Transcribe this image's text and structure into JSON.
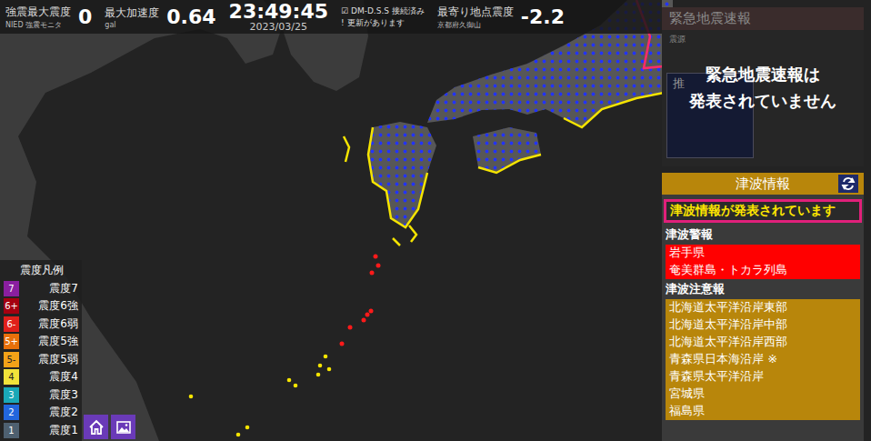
{
  "top_bar": {
    "max_intensity": {
      "label": "強震最大震度",
      "sub": "NIED 強震モニタ",
      "value": "0"
    },
    "max_acceleration": {
      "label": "最大加速度",
      "sub": "gal",
      "value": "0.64"
    },
    "clock": {
      "time": "23:49:45",
      "date": "2023/03/25"
    },
    "dmdss": {
      "icon": "☑",
      "status": "DM-D.S.S 接続済み",
      "update_icon": "!",
      "update": "更新があります"
    },
    "nearest": {
      "label": "最寄り地点震度",
      "sub": "京都府久御山",
      "value": "-2.2"
    }
  },
  "eew": {
    "title": "緊急地震速報",
    "hypocenter_label": "震源",
    "hidden_label": "推",
    "message_lines": [
      "緊急地震速報は",
      "発表されていません"
    ]
  },
  "tsunami": {
    "title": "津波情報",
    "status": "津波情報が発表されています",
    "groups": [
      {
        "label": "津波警報",
        "kind": "warning",
        "areas": [
          "岩手県",
          "奄美群島・トカラ列島"
        ]
      },
      {
        "label": "津波注意報",
        "kind": "advisory",
        "areas": [
          "北海道太平洋沿岸東部",
          "北海道太平洋沿岸中部",
          "北海道太平洋沿岸西部",
          "青森県日本海沿岸 ※",
          "青森県太平洋沿岸",
          "宮城県",
          "福島県"
        ]
      }
    ]
  },
  "legend": {
    "title": "震度凡例",
    "items": [
      {
        "badge": "7",
        "label": "震度7",
        "color": "#8a1fa0"
      },
      {
        "badge": "6+",
        "label": "震度6強",
        "color": "#a50010"
      },
      {
        "badge": "6-",
        "label": "震度6弱",
        "color": "#e0201a"
      },
      {
        "badge": "5+",
        "label": "震度5強",
        "color": "#e8700a"
      },
      {
        "badge": "5-",
        "label": "震度5弱",
        "color": "#f2a218"
      },
      {
        "badge": "4",
        "label": "震度4",
        "color": "#f2e23a"
      },
      {
        "badge": "3",
        "label": "震度3",
        "color": "#1aa8b8"
      },
      {
        "badge": "2",
        "label": "震度2",
        "color": "#2266dd"
      },
      {
        "badge": "1",
        "label": "震度1",
        "color": "#4e6070"
      }
    ]
  }
}
